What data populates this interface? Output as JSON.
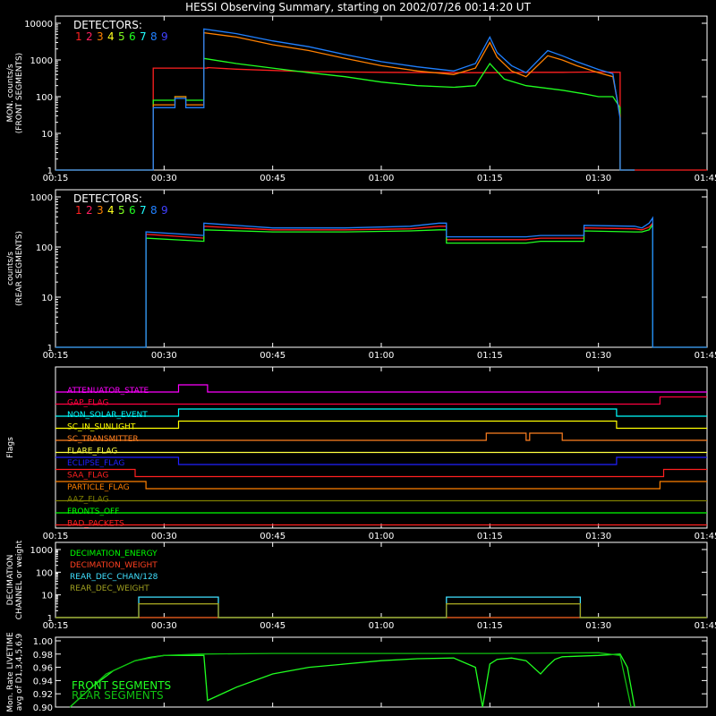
{
  "title": "HESSI Observing Summary, starting on 2002/07/26 00:14:20 UT",
  "x_axis": {
    "range_minutes": [
      15,
      54
    ],
    "tick_labels": [
      "00:15",
      "00:30",
      "00:45",
      "01:00",
      "01:15",
      "01:30",
      "01:45"
    ],
    "tick_minutes": [
      15,
      30,
      45,
      60,
      75,
      90,
      105
    ]
  },
  "colors": {
    "d1": "#ff2020",
    "d2": "#ff2060",
    "d3": "#ff8000",
    "d4": "#ffff20",
    "d5": "#80ff20",
    "d6": "#20ff20",
    "d7": "#20ffff",
    "d8": "#2080ff",
    "d9": "#4040ff",
    "attenuator": "#ff00ff",
    "gap": "#ff0040",
    "nonsolar": "#00ffff",
    "sunlight": "#ffff00",
    "transmitter": "#ff8020",
    "flare": "#ffff40",
    "eclipse": "#2020ff",
    "saa": "#ff2020",
    "particle": "#ff8000",
    "aaz": "#808000",
    "fronts": "#00ff00",
    "badpackets": "#ff2020",
    "dec_energy": "#00ff00",
    "dec_weight": "#ff4020",
    "rear_chan": "#40e0ff",
    "rear_weight": "#a0a020",
    "livetime_front": "#20ff20",
    "livetime_rear": "#10c010"
  },
  "chart_data": [
    {
      "type": "line",
      "name": "front",
      "ylabel": "MON_counts/s\n(FRONT SEGMENTS)",
      "ylabel_lines": [
        "MON. counts/s",
        "(FRONT SEGMENTS)"
      ],
      "yscale": "log",
      "ylim": [
        1,
        10000
      ],
      "ytick_labels": [
        "1",
        "10",
        "100",
        "1000",
        "10000"
      ],
      "legend_title": "DETECTORS:",
      "legend_entries": [
        "1",
        "2",
        "3",
        "4",
        "5",
        "6",
        "7",
        "8",
        "9"
      ],
      "series": [
        {
          "name": "1",
          "key": "d1",
          "x": [
            15,
            28.5,
            28.5,
            36,
            36,
            40,
            50,
            60,
            70,
            75,
            78,
            80,
            85,
            90,
            93,
            93,
            95,
            105
          ],
          "y": [
            1,
            1,
            600,
            600,
            620,
            560,
            480,
            460,
            450,
            450,
            450,
            460,
            460,
            470,
            460,
            1,
            1,
            1
          ]
        },
        {
          "name": "6",
          "key": "d6",
          "x": [
            15,
            28.5,
            28.5,
            31.5,
            31.5,
            33,
            33,
            35.5,
            35.5,
            40,
            45,
            50,
            55,
            60,
            65,
            70,
            73,
            75,
            77,
            80,
            85,
            88,
            90,
            92,
            93,
            93,
            95
          ],
          "y": [
            1,
            1,
            80,
            80,
            100,
            100,
            80,
            80,
            1100,
            800,
            600,
            450,
            350,
            250,
            200,
            180,
            200,
            800,
            300,
            200,
            150,
            120,
            100,
            100,
            50,
            1,
            1
          ]
        },
        {
          "name": "3",
          "key": "d3",
          "x": [
            15,
            28.5,
            28.5,
            31.5,
            31.5,
            33,
            33,
            35.5,
            35.5,
            40,
            45,
            50,
            55,
            60,
            65,
            70,
            73,
            75,
            76,
            78,
            80,
            83,
            85,
            87,
            90,
            92,
            93,
            93,
            95
          ],
          "y": [
            1,
            1,
            60,
            60,
            100,
            100,
            60,
            60,
            5500,
            4200,
            2600,
            1800,
            1100,
            700,
            500,
            400,
            600,
            3000,
            1200,
            500,
            350,
            1300,
            1000,
            700,
            450,
            350,
            30,
            1,
            1
          ]
        },
        {
          "name": "8",
          "key": "d8",
          "x": [
            15,
            28.5,
            28.5,
            31.5,
            31.5,
            33,
            33,
            35.5,
            35.5,
            40,
            45,
            50,
            55,
            60,
            65,
            70,
            73,
            75,
            76,
            78,
            80,
            83,
            85,
            87,
            90,
            92,
            93,
            93,
            95
          ],
          "y": [
            1,
            1,
            50,
            50,
            90,
            90,
            50,
            50,
            7000,
            5200,
            3300,
            2300,
            1400,
            900,
            650,
            500,
            800,
            4200,
            1600,
            700,
            450,
            1800,
            1300,
            900,
            550,
            420,
            25,
            1,
            1
          ]
        }
      ],
      "x_range": [
        15,
        105
      ]
    },
    {
      "type": "line",
      "name": "rear",
      "ylabel_lines": [
        "counts/s",
        "(REAR SEGMENTS)"
      ],
      "yscale": "log",
      "ylim": [
        1,
        1000
      ],
      "ytick_labels": [
        "1",
        "10",
        "100",
        "1000"
      ],
      "legend_title": "DETECTORS:",
      "legend_entries": [
        "1",
        "2",
        "3",
        "4",
        "5",
        "6",
        "7",
        "8",
        "9"
      ],
      "series": [
        {
          "name": "1",
          "key": "d1",
          "x": [
            15,
            27.5,
            27.5,
            35.5,
            35.5,
            45,
            55,
            64,
            68,
            69,
            69,
            80,
            82,
            87,
            88,
            88,
            95,
            96,
            97,
            97.5,
            97.5,
            105
          ],
          "y": [
            1,
            1,
            180,
            150,
            260,
            220,
            220,
            230,
            260,
            260,
            140,
            140,
            150,
            150,
            150,
            240,
            230,
            220,
            250,
            300,
            1,
            1
          ]
        },
        {
          "name": "6",
          "key": "d6",
          "x": [
            15,
            27.5,
            27.5,
            35.5,
            35.5,
            45,
            55,
            64,
            68,
            69,
            69,
            80,
            82,
            87,
            88,
            88,
            95,
            96,
            97,
            97.5,
            97.5,
            105
          ],
          "y": [
            1,
            1,
            150,
            130,
            220,
            200,
            200,
            210,
            220,
            220,
            120,
            120,
            130,
            130,
            130,
            210,
            200,
            200,
            220,
            280,
            1,
            1
          ]
        },
        {
          "name": "8",
          "key": "d8",
          "x": [
            15,
            27.5,
            27.5,
            35.5,
            35.5,
            45,
            55,
            64,
            68,
            69,
            69,
            80,
            82,
            87,
            88,
            88,
            95,
            96,
            97,
            97.5,
            97.5,
            105
          ],
          "y": [
            1,
            1,
            200,
            170,
            300,
            240,
            240,
            260,
            300,
            300,
            160,
            160,
            170,
            170,
            170,
            270,
            260,
            240,
            300,
            380,
            1,
            1
          ]
        }
      ],
      "x_range": [
        15,
        105
      ]
    },
    {
      "type": "line",
      "name": "flags",
      "ylabel_lines": [
        "Flags"
      ],
      "rows": [
        {
          "label": "ATTENUATOR_STATE",
          "key": "attenuator",
          "segments": [
            [
              15,
              32,
              0
            ],
            [
              32,
              36,
              1
            ],
            [
              36,
              105,
              0
            ]
          ]
        },
        {
          "label": "GAP_FLAG",
          "key": "gap",
          "segments": [
            [
              15,
              98.5,
              0
            ],
            [
              98.5,
              105,
              1
            ]
          ]
        },
        {
          "label": "NON_SOLAR_EVENT",
          "key": "nonsolar",
          "segments": [
            [
              15,
              32,
              0
            ],
            [
              32,
              92.5,
              1
            ],
            [
              92.5,
              105,
              0
            ]
          ]
        },
        {
          "label": "SC_IN_SUNLIGHT",
          "key": "sunlight",
          "segments": [
            [
              15,
              32,
              0
            ],
            [
              32,
              92.5,
              1
            ],
            [
              92.5,
              105,
              0
            ]
          ]
        },
        {
          "label": "SC_TRANSMITTER",
          "key": "transmitter",
          "segments": [
            [
              15,
              74.5,
              0
            ],
            [
              74.5,
              80,
              1
            ],
            [
              80,
              80.5,
              0
            ],
            [
              80.5,
              85,
              1
            ],
            [
              85,
              105,
              0
            ]
          ]
        },
        {
          "label": "FLARE_FLAG",
          "key": "flare",
          "segments": [
            [
              15,
              105,
              0
            ]
          ]
        },
        {
          "label": "ECLIPSE_FLAG",
          "key": "eclipse",
          "segments": [
            [
              15,
              32,
              1
            ],
            [
              32,
              92.5,
              0
            ],
            [
              92.5,
              105,
              1
            ]
          ]
        },
        {
          "label": "SAA_FLAG",
          "key": "saa",
          "segments": [
            [
              15,
              26,
              1
            ],
            [
              26,
              99,
              0
            ],
            [
              99,
              105,
              1
            ]
          ]
        },
        {
          "label": "PARTICLE_FLAG",
          "key": "particle",
          "segments": [
            [
              15,
              27.5,
              1
            ],
            [
              27.5,
              98.5,
              0
            ],
            [
              98.5,
              105,
              1
            ]
          ]
        },
        {
          "label": "AAZ_FLAG",
          "key": "aaz",
          "segments": [
            [
              15,
              105,
              0
            ]
          ]
        },
        {
          "label": "FRONTS_OFF",
          "key": "fronts",
          "segments": [
            [
              15,
              105,
              0
            ]
          ]
        },
        {
          "label": "BAD_PACKETS",
          "key": "badpackets",
          "segments": [
            [
              15,
              105,
              0
            ]
          ]
        }
      ],
      "x_range": [
        15,
        105
      ]
    },
    {
      "type": "line",
      "name": "decimation",
      "ylabel_lines": [
        "DECIMATION",
        "CHANNEL or weight"
      ],
      "yscale": "log",
      "ylim": [
        1,
        1000
      ],
      "ytick_labels": [
        "1",
        "10",
        "100",
        "1000"
      ],
      "legend_entries": [
        "DECIMATION_ENERGY",
        "DECIMATION_WEIGHT",
        "REAR_DEC_CHAN/128",
        "REAR_DEC_WEIGHT"
      ],
      "series": [
        {
          "name": "DECIMATION_ENERGY",
          "key": "dec_energy",
          "x": [
            15,
            105
          ],
          "y": [
            1,
            1
          ]
        },
        {
          "name": "DECIMATION_WEIGHT",
          "key": "dec_weight",
          "x": [
            15,
            105
          ],
          "y": [
            1,
            1
          ]
        },
        {
          "name": "REAR_DEC_CHAN/128",
          "key": "rear_chan",
          "x": [
            15,
            26.5,
            26.5,
            37.5,
            37.5,
            69,
            69,
            87.5,
            87.5,
            105
          ],
          "y": [
            1,
            1,
            8,
            8,
            1,
            1,
            8,
            8,
            1,
            1
          ]
        },
        {
          "name": "REAR_DEC_WEIGHT",
          "key": "rear_weight",
          "x": [
            15,
            26.5,
            26.5,
            37.5,
            37.5,
            69,
            69,
            87.5,
            87.5,
            105
          ],
          "y": [
            1,
            1,
            4,
            4,
            1,
            1,
            4,
            4,
            1,
            1
          ]
        }
      ],
      "x_range": [
        15,
        105
      ]
    },
    {
      "type": "line",
      "name": "livetime",
      "ylabel_lines": [
        "Mon. Rate LIVETIME",
        "avg of D1,3,4,5,6,9"
      ],
      "ylim": [
        0.9,
        1.0
      ],
      "ytick_labels": [
        "0.90",
        "0.92",
        "0.94",
        "0.96",
        "0.98",
        "1.00"
      ],
      "legend_entries": [
        "FRONT SEGMENTS",
        "REAR SEGMENTS"
      ],
      "series": [
        {
          "name": "FRONT SEGMENTS",
          "key": "livetime_front",
          "x": [
            17,
            20,
            23,
            26,
            28,
            30,
            32,
            34,
            35.5,
            36,
            40,
            45,
            50,
            55,
            60,
            65,
            70,
            73,
            74,
            75,
            76,
            78,
            80,
            82,
            83,
            84,
            85,
            90,
            93,
            94,
            95
          ],
          "y": [
            0.9,
            0.93,
            0.955,
            0.97,
            0.975,
            0.978,
            0.978,
            0.978,
            0.978,
            0.91,
            0.93,
            0.95,
            0.96,
            0.965,
            0.97,
            0.973,
            0.974,
            0.96,
            0.9,
            0.965,
            0.972,
            0.974,
            0.97,
            0.95,
            0.962,
            0.972,
            0.976,
            0.978,
            0.98,
            0.96,
            0.9
          ]
        },
        {
          "name": "REAR SEGMENTS",
          "key": "livetime_rear",
          "x": [
            17,
            22,
            26,
            30,
            35,
            45,
            60,
            75,
            90,
            93,
            94.5
          ],
          "y": [
            0.9,
            0.95,
            0.97,
            0.978,
            0.98,
            0.981,
            0.981,
            0.981,
            0.982,
            0.978,
            0.9
          ]
        }
      ],
      "x_range": [
        15,
        105
      ]
    }
  ]
}
